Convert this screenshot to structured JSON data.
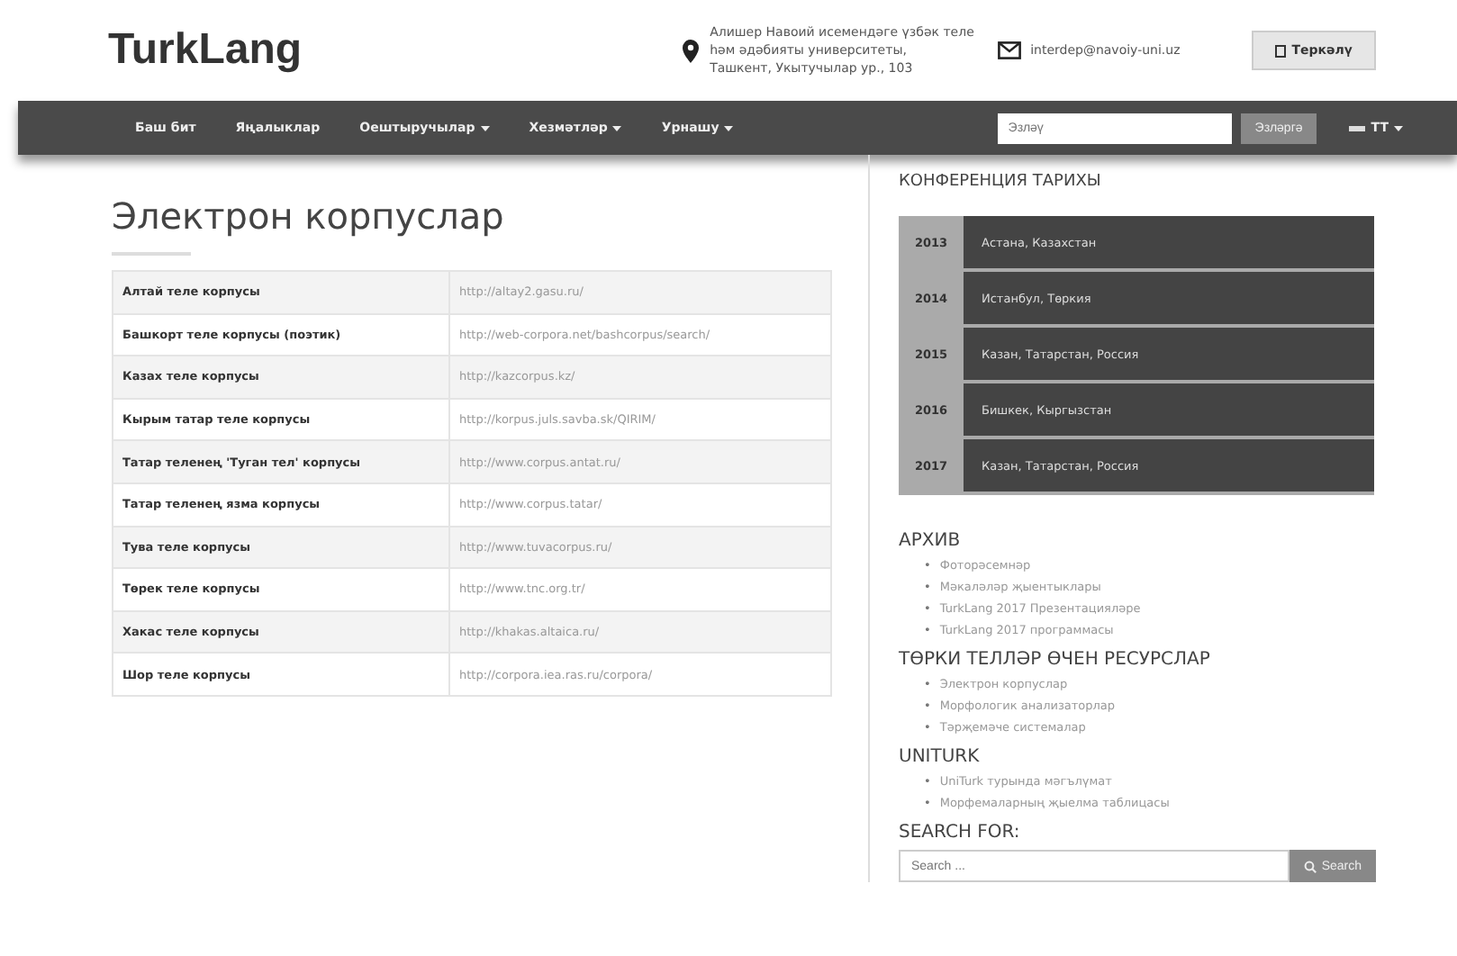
{
  "header": {
    "logo": "TurkLang",
    "address": [
      "Алишер Навоий исемендәге үзбәк теле",
      "һәм әдәбияты университеты,",
      "Ташкент, Укытучылар ур., 103"
    ],
    "email": "interdep@navoiy-uni.uz",
    "register_button": "Теркәлү"
  },
  "nav": {
    "items": [
      {
        "label": "Баш бит",
        "dropdown": false
      },
      {
        "label": "Яңалыклар",
        "dropdown": false
      },
      {
        "label": "Оештыручылар",
        "dropdown": true
      },
      {
        "label": "Хезмәтләр",
        "dropdown": true
      },
      {
        "label": "Урнашу",
        "dropdown": true
      }
    ],
    "search": {
      "placeholder": "Эзләү"
    },
    "search_button": "Эзләргә",
    "language": "TT"
  },
  "main": {
    "title": "Электрон корпуслар",
    "table": {
      "rows": [
        {
          "name": "Алтай теле корпусы",
          "url": "http://altay2.gasu.ru/"
        },
        {
          "name": "Башкорт теле корпусы (поэтик)",
          "url": "http://web-corpora.net/bashcorpus/search/"
        },
        {
          "name": "Казах теле корпусы",
          "url": "http://kazcorpus.kz/"
        },
        {
          "name": "Кырым татар теле корпусы",
          "url": "http://korpus.juls.savba.sk/QIRIM/"
        },
        {
          "name": "Татар теленең 'Туган тел' корпусы",
          "url": "http://www.corpus.antat.ru/"
        },
        {
          "name": "Татар теленең язма корпусы",
          "url": "http://www.corpus.tatar/"
        },
        {
          "name": "Тува теле корпусы",
          "url": "http://www.tuvacorpus.ru/"
        },
        {
          "name": "Төрек теле корпусы",
          "url": "http://www.tnc.org.tr/"
        },
        {
          "name": "Хакас теле корпусы",
          "url": "http://khakas.altaica.ru/"
        },
        {
          "name": "Шор теле корпусы",
          "url": "http://corpora.iea.ras.ru/corpora/"
        }
      ]
    }
  },
  "sidebar": {
    "history_title": "КОНФЕРЕНЦИЯ ТАРИХЫ",
    "history": [
      {
        "year": "2013",
        "place": "Астана, Казахстан"
      },
      {
        "year": "2014",
        "place": "Истанбул, Төркия"
      },
      {
        "year": "2015",
        "place": "Казан, Татарстан, Россия"
      },
      {
        "year": "2016",
        "place": "Бишкек, Кыргызстан"
      },
      {
        "year": "2017",
        "place": "Казан, Татарстан, Россия"
      }
    ],
    "bullet": "•",
    "sections": [
      {
        "title": "АРХИВ",
        "links": [
          "Фоторәсемнәр",
          "Мәкаләләр җыентыклары",
          "TurkLang 2017 Презентацияләре",
          "TurkLang 2017 программасы"
        ]
      },
      {
        "title": "ТӨРКИ ТЕЛЛӘР ӨЧЕН РЕСУРСЛАР",
        "links": [
          "Электрон корпуслар",
          "Морфологик анализаторлар",
          "Тәрҗемәче системалар"
        ]
      },
      {
        "title": "UNITURK",
        "links": [
          "UniTurk турында мәгълүмат",
          "Морфемаларның җыелма таблицасы"
        ]
      }
    ],
    "search_title": "SEARCH FOR:",
    "search": {
      "placeholder": "Search ..."
    },
    "search_button": "Search"
  }
}
